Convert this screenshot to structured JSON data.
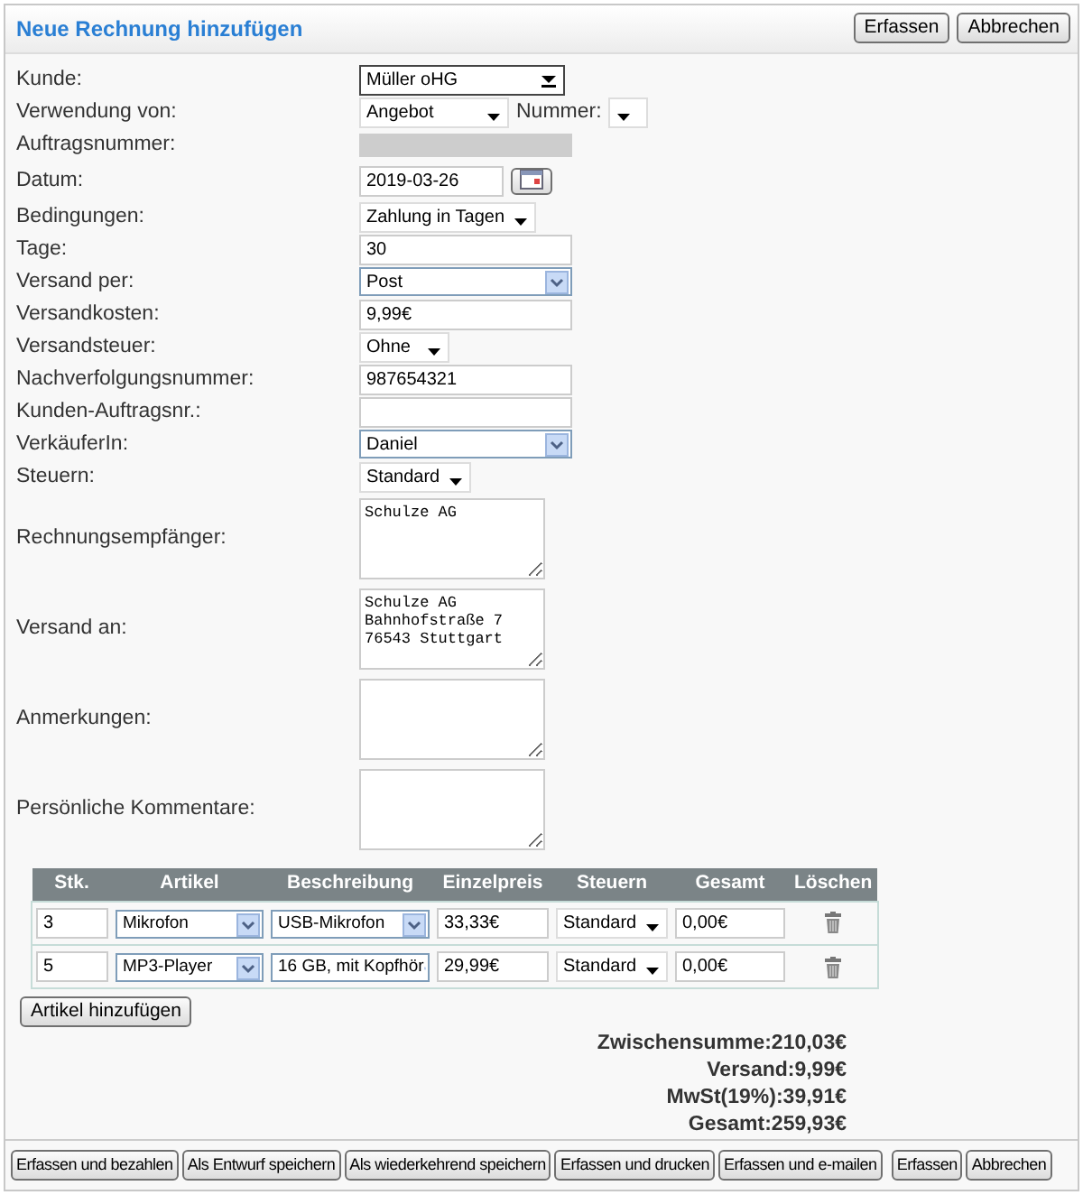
{
  "header": {
    "title": "Neue Rechnung hinzufügen",
    "buttons": [
      "Erfassen",
      "Abbrechen"
    ]
  },
  "fields": [
    {
      "label": "Kunde:",
      "kind": "combo",
      "value": "Müller oHG"
    },
    {
      "label": "Verwendung von:",
      "kind": "select",
      "value": "Angebot",
      "extra_label": "Nummer:"
    },
    {
      "label": "Auftragsnummer:",
      "kind": "disabled"
    },
    {
      "label": "Datum:",
      "kind": "date",
      "value": "2019-03-26"
    },
    {
      "label": "Bedingungen:",
      "kind": "select",
      "value": "Zahlung in Tagen"
    },
    {
      "label": "Tage:",
      "kind": "input",
      "value": "30"
    },
    {
      "label": "Versand per:",
      "kind": "blue-select",
      "value": "Post"
    },
    {
      "label": "Versandkosten:",
      "kind": "input",
      "value": "9,99€"
    },
    {
      "label": "Versandsteuer:",
      "kind": "select",
      "value": "Ohne"
    },
    {
      "label": "Nachverfolgungsnummer:",
      "kind": "input",
      "value": "987654321"
    },
    {
      "label": "Kunden-Auftragsnr.:",
      "kind": "input"
    },
    {
      "label": "VerkäuferIn:",
      "kind": "blue-select",
      "value": "Daniel"
    },
    {
      "label": "Steuern:",
      "kind": "select",
      "value": "Standard"
    },
    {
      "label": "Rechnungsempfänger:",
      "kind": "textarea",
      "value": "Schulze AG"
    },
    {
      "label": "Versand an:",
      "kind": "textarea",
      "value": "Schulze AG\nBahnhofstraße 7\n76543 Stuttgart"
    },
    {
      "label": "Anmerkungen:",
      "kind": "textarea"
    },
    {
      "label": "Persönliche Kommentare:",
      "kind": "textarea"
    }
  ],
  "items_table": {
    "columns": [
      "Stk.",
      "Artikel",
      "Beschreibung",
      "Einzelpreis",
      "Steuern",
      "Gesamt",
      "Löschen"
    ],
    "rows": [
      {
        "quantity": "3",
        "article": "Mikrofon",
        "description": "USB-Mikrofon",
        "unit_price": "33,33€",
        "tax": "Standard",
        "total": "0,00€"
      },
      {
        "quantity": "5",
        "article": "MP3-Player",
        "description": "16 GB, mit Kopfhör",
        "unit_price": "29,99€",
        "tax": "Standard",
        "total": "0,00€"
      }
    ],
    "add_button": "Artikel hinzufügen"
  },
  "totals": [
    "Zwischensumme:210,03€",
    "Versand:9,99€",
    "MwSt(19%):39,91€",
    "Gesamt:259,93€"
  ],
  "footer_buttons": [
    "Erfassen und bezahlen",
    "Als Entwurf speichern",
    "Als wiederkehrend speichern",
    "Erfassen und drucken",
    "Erfassen und e-mailen",
    "Erfassen",
    "Abbrechen"
  ]
}
